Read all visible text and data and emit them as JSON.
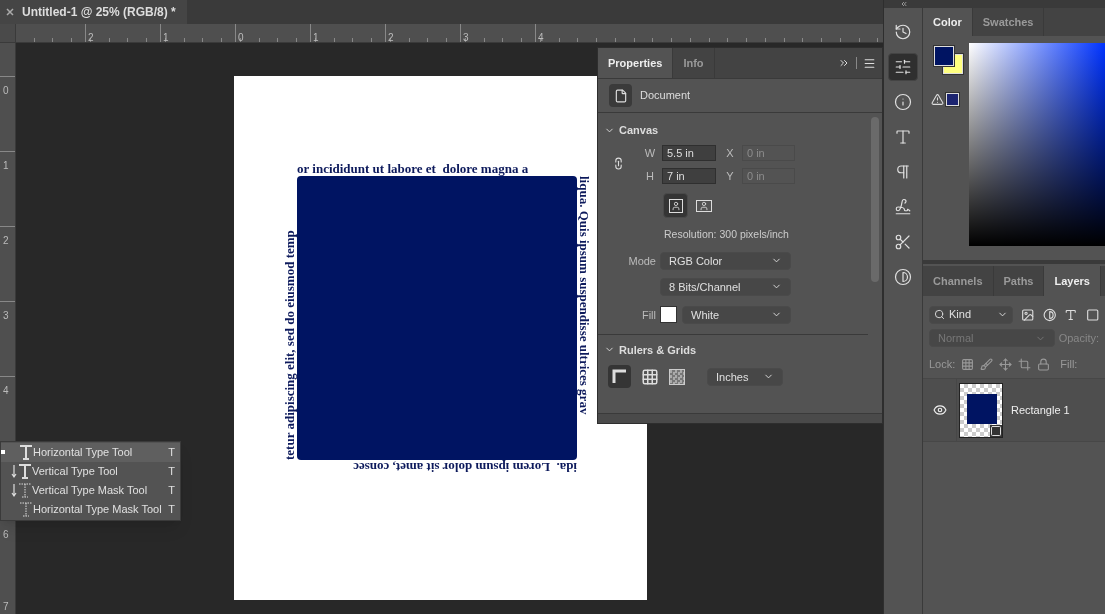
{
  "document_tab": {
    "title": "Untitled-1 @ 25% (RGB/8) *"
  },
  "top_ruler": [
    "2",
    "1",
    "0",
    "1",
    "2",
    "3",
    "4"
  ],
  "left_ruler": {
    "upper": [
      "0",
      "1",
      "2",
      "3",
      "4"
    ],
    "lower": [
      "6",
      "7"
    ]
  },
  "canvas_text": {
    "top": "or incididunt ut labore et  dolore magna a",
    "right": "liqua. Quis ipsum suspendisse ultrices grav",
    "bottom": "ida.  Lorem ipsum dolor sit amet, consec",
    "left": "tetur adipiscing elit, sed do eiusmod temp"
  },
  "properties": {
    "tabs": [
      {
        "label": "Properties",
        "selected": true
      },
      {
        "label": "Info",
        "selected": false
      }
    ],
    "header": "Document",
    "canvas": {
      "title": "Canvas",
      "expanded": true,
      "w_label": "W",
      "w": "5.5 in",
      "x_label": "X",
      "x": "0 in",
      "h_label": "H",
      "h": "7 in",
      "y_label": "Y",
      "y": "0 in",
      "orientation": [
        {
          "kind": "portrait",
          "selected": true
        },
        {
          "kind": "landscape",
          "selected": false
        }
      ],
      "resolution": "Resolution: 300 pixels/inch",
      "mode_label": "Mode",
      "mode": "RGB Color",
      "depth": "8 Bits/Channel",
      "fill_label": "Fill",
      "fill": "White"
    },
    "rulers": {
      "title": "Rulers & Grids",
      "expanded": true,
      "units": "Inches"
    }
  },
  "tool_flyout": [
    {
      "kind": "horizontal",
      "label": "Horizontal Type Tool",
      "shortcut": "T",
      "selected": true
    },
    {
      "kind": "vertical",
      "label": "Vertical Type Tool",
      "shortcut": "T",
      "selected": false
    },
    {
      "kind": "vertical-mask",
      "label": "Vertical Type Mask Tool",
      "shortcut": "T",
      "selected": false
    },
    {
      "kind": "horizontal-mask",
      "label": "Horizontal Type Mask Tool",
      "shortcut": "T",
      "selected": false
    }
  ],
  "dock_icons": [
    {
      "kind": "history",
      "selected": false
    },
    {
      "kind": "adjust",
      "selected": true
    },
    {
      "kind": "info",
      "selected": false
    },
    {
      "kind": "character",
      "selected": false
    },
    {
      "kind": "paragraph",
      "selected": false
    },
    {
      "kind": "glyphs",
      "selected": false
    },
    {
      "kind": "tools",
      "selected": false
    },
    {
      "kind": "contrast",
      "selected": false
    }
  ],
  "color_panel": {
    "tabs": [
      {
        "label": "Color",
        "selected": true
      },
      {
        "label": "Swatches",
        "selected": false
      }
    ],
    "swatches": [
      {
        "kind": "foreground",
        "color": "#001462"
      },
      {
        "kind": "background",
        "color": "#ffff80"
      },
      {
        "kind": "gamut",
        "color": "#1c2470"
      }
    ]
  },
  "layers_panel": {
    "tabs": [
      {
        "label": "Channels",
        "selected": false
      },
      {
        "label": "Paths",
        "selected": false
      },
      {
        "label": "Layers",
        "selected": true
      }
    ],
    "filter": "Kind",
    "blend_mode": "Normal",
    "opacity_label": "Opacity:",
    "lock_label": "Lock:",
    "fill_label": "Fill:",
    "layers": [
      {
        "name": "Rectangle 1",
        "visible": true,
        "color": "#001462"
      }
    ]
  }
}
